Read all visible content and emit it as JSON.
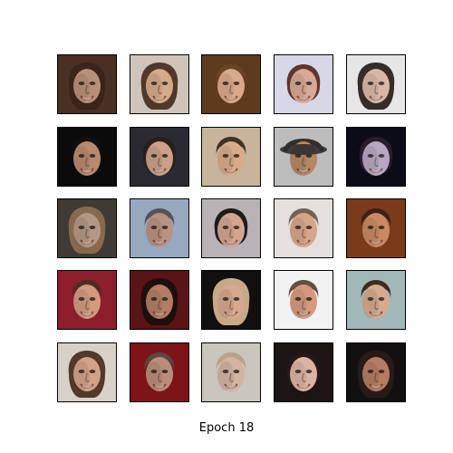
{
  "figure": {
    "caption": "Epoch 18",
    "tiles": [
      {
        "bg": "#4a2f24",
        "skin": "#b88f78",
        "hair": "#3a2418",
        "style": "long"
      },
      {
        "bg": "#cfc4bb",
        "skin": "#d4aa8a",
        "hair": "#4a3022",
        "style": "long"
      },
      {
        "bg": "#5e3a1e",
        "skin": "#d9a98c",
        "hair": "#6b4424",
        "style": "short"
      },
      {
        "bg": "#d7d7e6",
        "skin": "#d8a996",
        "hair": "#5a2c22",
        "style": "bob"
      },
      {
        "bg": "#e7e6e6",
        "skin": "#d9b8a6",
        "hair": "#2b2320",
        "style": "long"
      },
      {
        "bg": "#0b0b0b",
        "skin": "#b78a6e",
        "hair": "#151010",
        "style": "short"
      },
      {
        "bg": "#2b2a33",
        "skin": "#caa08a",
        "hair": "#2a1f1a",
        "style": "bob"
      },
      {
        "bg": "#c7b49a",
        "skin": "#d8ab8a",
        "hair": "#3b2a1f",
        "style": "short"
      },
      {
        "bg": "#bdbdbd",
        "skin": "#b58867",
        "hair": "#2d2723",
        "style": "hat"
      },
      {
        "bg": "#0c0c18",
        "skin": "#b7a7c2",
        "hair": "#2b1f2d",
        "style": "bob"
      },
      {
        "bg": "#3f3a33",
        "skin": "#b59785",
        "hair": "#8b6d50",
        "style": "long"
      },
      {
        "bg": "#98a9bf",
        "skin": "#b99282",
        "hair": "#4f4f55",
        "style": "short"
      },
      {
        "bg": "#b7b3b6",
        "skin": "#d2a58f",
        "hair": "#171313",
        "style": "bob"
      },
      {
        "bg": "#e5e0dc",
        "skin": "#d7a58b",
        "hair": "#6b5c4f",
        "style": "short"
      },
      {
        "bg": "#7a3b1a",
        "skin": "#c98a62",
        "hair": "#3b1f12",
        "style": "short"
      },
      {
        "bg": "#8d1e2b",
        "skin": "#d39a80",
        "hair": "#4a2d22",
        "style": "short"
      },
      {
        "bg": "#5a1316",
        "skin": "#b27d64",
        "hair": "#1b0f0c",
        "style": "long"
      },
      {
        "bg": "#120f10",
        "skin": "#d6a88f",
        "hair": "#d2b28e",
        "style": "long"
      },
      {
        "bg": "#f2f2f2",
        "skin": "#d49a80",
        "hair": "#5b4438",
        "style": "short"
      },
      {
        "bg": "#a2b7b8",
        "skin": "#d4aa90",
        "hair": "#3a2318",
        "style": "short"
      },
      {
        "bg": "#d7d1c7",
        "skin": "#d2a187",
        "hair": "#4b3022",
        "style": "long"
      },
      {
        "bg": "#7d1418",
        "skin": "#b98d79",
        "hair": "#5a4a44",
        "style": "short"
      },
      {
        "bg": "#c9c6be",
        "skin": "#d3b3a1",
        "hair": "#b89f87",
        "style": "short"
      },
      {
        "bg": "#1d1414",
        "skin": "#d9b3a3",
        "hair": "#2a1713",
        "style": "bob"
      },
      {
        "bg": "#120f10",
        "skin": "#b57c62",
        "hair": "#2a1c18",
        "style": "long"
      }
    ]
  }
}
